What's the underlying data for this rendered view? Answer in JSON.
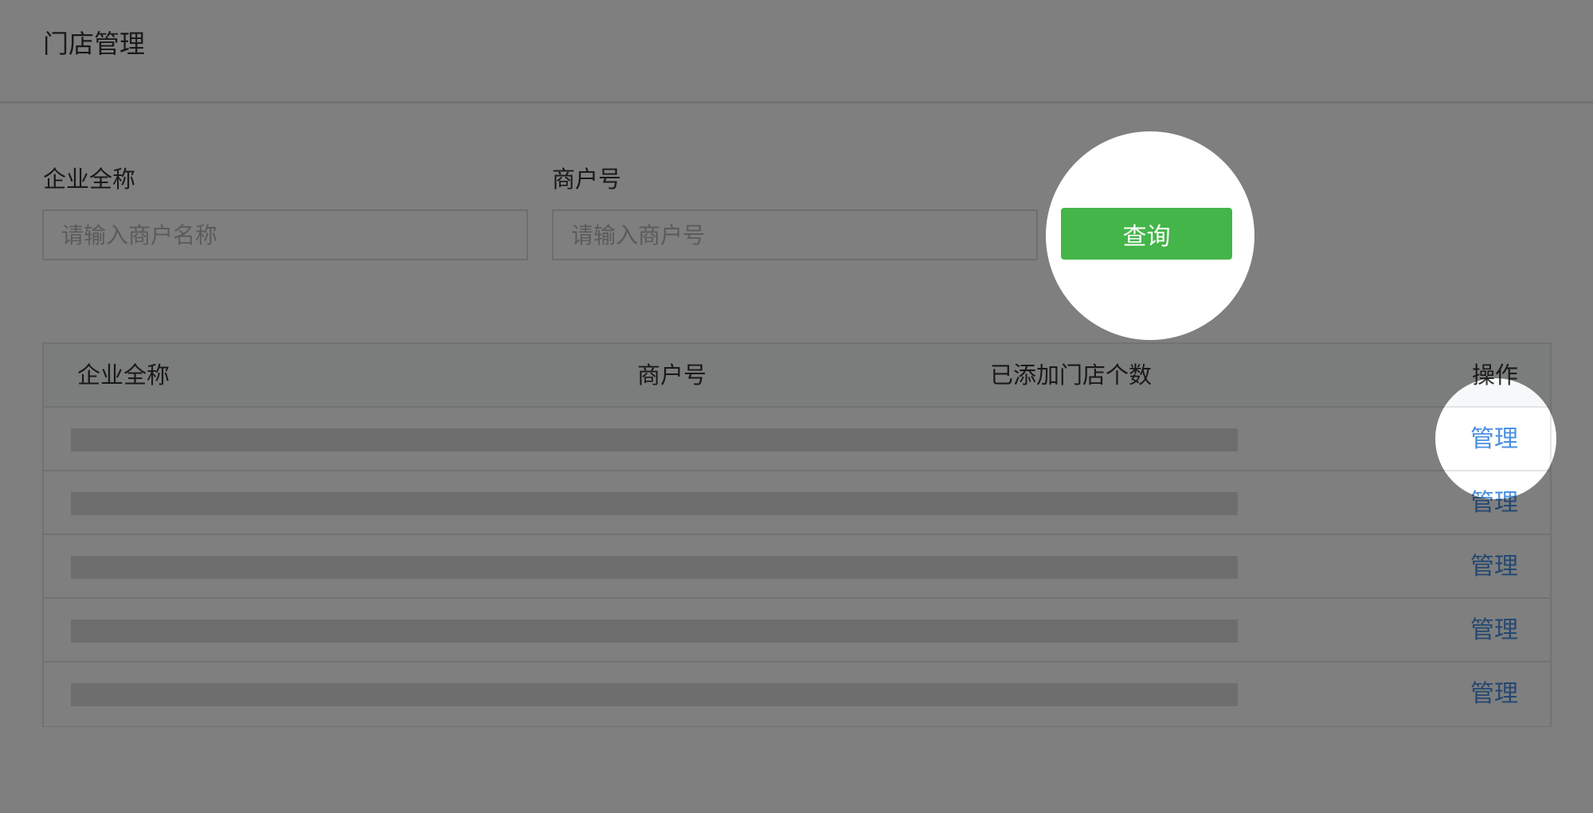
{
  "header": {
    "title": "门店管理"
  },
  "filters": {
    "company_label": "企业全称",
    "company_placeholder": "请输入商户名称",
    "merchant_label": "商户号",
    "merchant_placeholder": "请输入商户号",
    "query_button": "查询"
  },
  "table": {
    "columns": [
      "企业全称",
      "商户号",
      "已添加门店个数",
      "操作"
    ],
    "rows": [
      {
        "action": "管理"
      },
      {
        "action": "管理"
      },
      {
        "action": "管理"
      },
      {
        "action": "管理"
      },
      {
        "action": "管理"
      }
    ]
  },
  "colors": {
    "primary_button": "#44b549",
    "link": "#4a90e2",
    "overlay_dim": "#000000"
  }
}
